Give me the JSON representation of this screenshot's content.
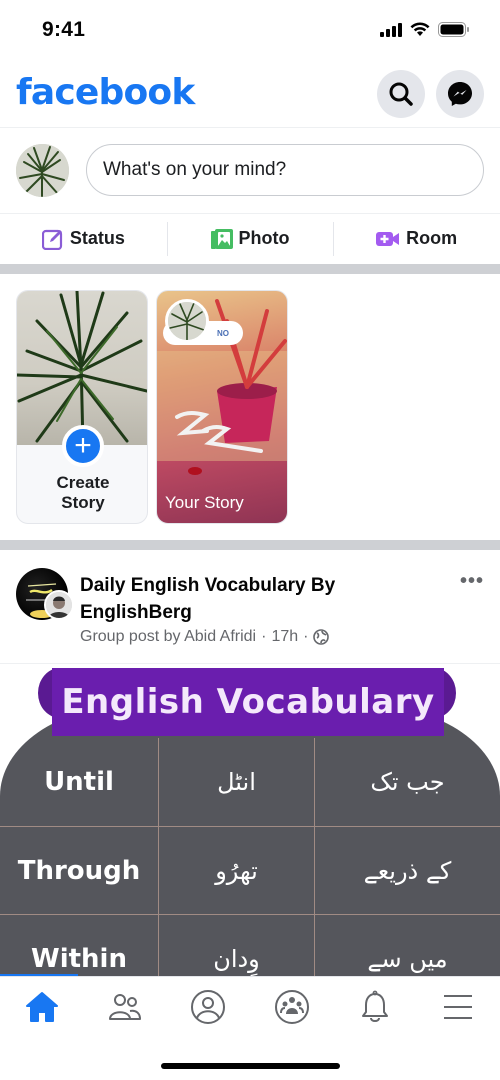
{
  "status_bar": {
    "time": "9:41",
    "icons": [
      "cellular-signal-icon",
      "wifi-icon",
      "battery-icon"
    ]
  },
  "header": {
    "logo": "facebook",
    "brand_color": "#1877f2",
    "buttons": [
      {
        "name": "search",
        "icon": "search-icon"
      },
      {
        "name": "messenger",
        "icon": "messenger-icon"
      }
    ]
  },
  "composer": {
    "placeholder": "What's on your mind?"
  },
  "actions": [
    {
      "label": "Status",
      "icon": "edit-icon",
      "color": "#8a5cd6"
    },
    {
      "label": "Photo",
      "icon": "photo-icon",
      "color": "#45bd62"
    },
    {
      "label": "Room",
      "icon": "video-room-icon",
      "color": "#a35bf0"
    }
  ],
  "stories": {
    "create": {
      "line1": "Create",
      "line2": "Story"
    },
    "your_story": {
      "label": "Your Story",
      "poll_option": "NO"
    }
  },
  "post": {
    "group_name": "Daily English Vocabulary By EnglishBerg",
    "meta": "Group post by Abid Afridi",
    "time": "17h",
    "privacy_icon": "globe-icon",
    "more": "•••",
    "image": {
      "title": "English Vocabulary",
      "rows": [
        {
          "english": "Until",
          "pronunciation": "انٹل",
          "meaning": "جب تک"
        },
        {
          "english": "Through",
          "pronunciation": "تھرُو",
          "meaning": "کے ذریعے"
        },
        {
          "english": "Within",
          "pronunciation": "وِدان",
          "meaning": "میں سے"
        }
      ]
    }
  },
  "tabbar": [
    {
      "name": "home",
      "icon": "home-icon",
      "active": true
    },
    {
      "name": "friends",
      "icon": "friends-icon",
      "active": false
    },
    {
      "name": "profile",
      "icon": "profile-icon",
      "active": false
    },
    {
      "name": "groups",
      "icon": "groups-icon",
      "active": false
    },
    {
      "name": "notifications",
      "icon": "bell-icon",
      "active": false
    },
    {
      "name": "menu",
      "icon": "menu-icon",
      "active": false
    }
  ]
}
